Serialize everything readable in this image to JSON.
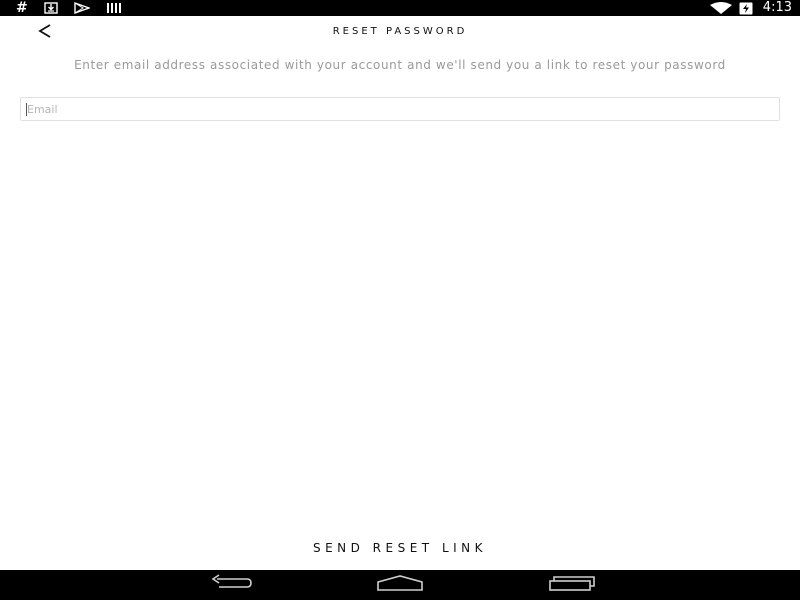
{
  "status_bar": {
    "left_icons": [
      "hash-icon",
      "download-icon",
      "play-store-icon",
      "signal-bars-icon"
    ],
    "right_icons": [
      "wifi-icon",
      "battery-charging-icon"
    ],
    "time": "4:13"
  },
  "header": {
    "back_icon": "chevron-left-icon",
    "title": "RESET PASSWORD"
  },
  "main": {
    "instructions": "Enter email address associated with your account and we'll send you a link to reset your password",
    "email": {
      "placeholder": "Email",
      "value": ""
    },
    "send_button_label": "SEND RESET LINK"
  },
  "nav_bar": {
    "items": [
      "back-nav-icon",
      "home-nav-icon",
      "recents-nav-icon"
    ]
  },
  "colors": {
    "status_bar_bg": "#000000",
    "nav_bar_bg": "#000000",
    "background": "#ffffff",
    "instruction_text": "#9a9a9a",
    "input_border": "#e0e0e0"
  }
}
